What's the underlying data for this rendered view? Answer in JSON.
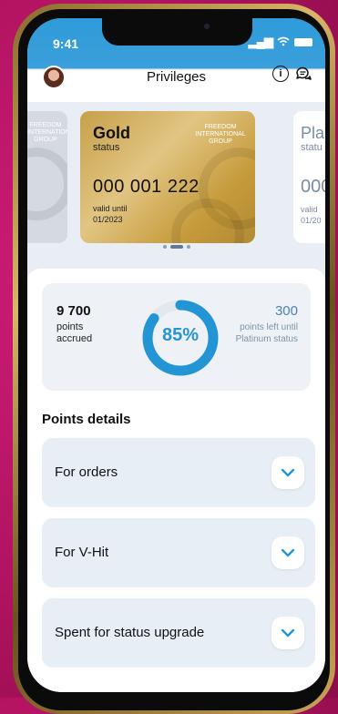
{
  "status_bar": {
    "time": "9:41"
  },
  "header": {
    "title": "Privileges",
    "info_glyph": "i"
  },
  "cards": {
    "left": {
      "brand": "FREEDOM INTERNATIONAL GROUP"
    },
    "gold": {
      "tier": "Gold",
      "status": "status",
      "brand": "FREEDOM INTERNATIONAL GROUP",
      "number": "000 001 222",
      "valid_label": "valid until",
      "valid_date": "01/2023",
      "color": "#c9a34d"
    },
    "right": {
      "tier": "Pla",
      "status": "statu",
      "number": "000",
      "valid": "valid\n01/20"
    }
  },
  "points": {
    "accrued_value": "9 700",
    "accrued_label": "points accrued",
    "percent": "85%",
    "progress_fraction": 0.85,
    "left_value": "300",
    "left_label": "points left until Platinum status",
    "accent_color": "#2394d4"
  },
  "details": {
    "title": "Points details",
    "items": [
      {
        "label": "For orders"
      },
      {
        "label": "For V-Hit"
      },
      {
        "label": "Spent for status upgrade"
      }
    ]
  }
}
